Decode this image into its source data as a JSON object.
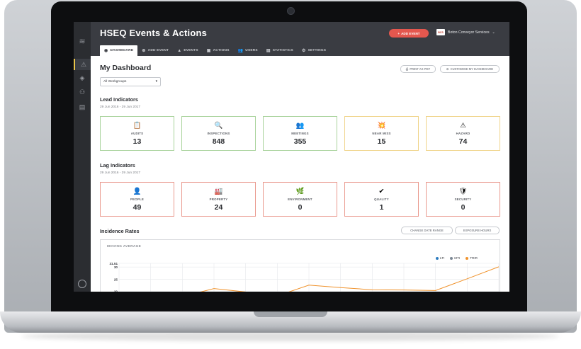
{
  "app": {
    "title": "HSEQ Events & Actions",
    "add_event_button": "ADD EVENT",
    "company": "Boton Conveyor Services",
    "company_logo_text": "BCS"
  },
  "nav": [
    {
      "label": "DASHBOARD",
      "icon": "dashboard-icon",
      "glyph": "◉"
    },
    {
      "label": "ADD EVENT",
      "icon": "plus-circle-icon",
      "glyph": "⊕"
    },
    {
      "label": "EVENTS",
      "icon": "warning-icon",
      "glyph": "▲"
    },
    {
      "label": "ACTIONS",
      "icon": "calendar-icon",
      "glyph": "▣"
    },
    {
      "label": "USERS",
      "icon": "users-icon",
      "glyph": "👥"
    },
    {
      "label": "STATISTICS",
      "icon": "bar-chart-icon",
      "glyph": "▤"
    },
    {
      "label": "SETTINGS",
      "icon": "gear-icon",
      "glyph": "⚙"
    }
  ],
  "dashboard": {
    "title": "My Dashboard",
    "print_pdf": "PRINT AS PDF",
    "customise": "CUSTOMISE MY DASHBOARD",
    "workgroup_select": "All Workgroups"
  },
  "lead": {
    "title": "Lead Indicators",
    "date_range": "29 Jun 2016 - 29 Jun 2017",
    "cards": [
      {
        "label": "AUDITS",
        "value": "13",
        "icon": "clipboard-icon",
        "glyph": "📋",
        "color": "#a9d39c"
      },
      {
        "label": "INSPECTIONS",
        "value": "848",
        "icon": "magnifier-icon",
        "glyph": "🔍",
        "color": "#a9d39c"
      },
      {
        "label": "MEETINGS",
        "value": "355",
        "icon": "meeting-icon",
        "glyph": "👥",
        "color": "#a9d39c"
      },
      {
        "label": "NEAR MISS",
        "value": "15",
        "icon": "explosion-icon",
        "glyph": "💥",
        "color": "#f0d48a"
      },
      {
        "label": "HAZARD",
        "value": "74",
        "icon": "hazard-icon",
        "glyph": "⚠",
        "color": "#f0d48a"
      }
    ]
  },
  "lag": {
    "title": "Lag Indicators",
    "date_range": "29 Jun 2016 - 29 Jun 2017",
    "cards": [
      {
        "label": "PEOPLE",
        "value": "49",
        "icon": "person-icon",
        "glyph": "👤",
        "color": "#ea9a8f"
      },
      {
        "label": "PROPERTY",
        "value": "24",
        "icon": "factory-icon",
        "glyph": "🏭",
        "color": "#ea9a8f"
      },
      {
        "label": "ENVIRONMENT",
        "value": "0",
        "icon": "leaf-icon",
        "glyph": "🌿",
        "color": "#ea9a8f"
      },
      {
        "label": "QUALITY",
        "value": "1",
        "icon": "check-badge-icon",
        "glyph": "✔",
        "color": "#ea9a8f"
      },
      {
        "label": "SECURITY",
        "value": "0",
        "icon": "shield-icon",
        "glyph": "🛡",
        "color": "#ea9a8f"
      }
    ]
  },
  "incidence": {
    "title": "Incidence Rates",
    "change_date_button": "CHANGE DATE RANGE",
    "exposure_button": "EXPOSURE HOURS",
    "subtitle": "MOVING AVERAGE"
  },
  "chart_data": {
    "type": "line",
    "x": [
      0,
      1,
      2,
      3,
      4,
      5,
      6,
      7,
      8,
      9,
      10,
      11,
      12
    ],
    "ylim": [
      15,
      31.51
    ],
    "yticks": [
      "31.51",
      "30",
      "25",
      "20"
    ],
    "series": [
      {
        "name": "LTI",
        "color": "#2e7cc0",
        "values": []
      },
      {
        "name": "MTI",
        "color": "#7b8794",
        "values": []
      },
      {
        "name": "TRIR",
        "color": "#f0922b",
        "values": [
          17.8,
          17.8,
          17.9,
          21.2,
          19.8,
          18.2,
          22.6,
          21.6,
          20.7,
          20.6,
          20.4,
          25.2,
          30.1
        ]
      }
    ],
    "legend": "top-right",
    "grid": true
  }
}
